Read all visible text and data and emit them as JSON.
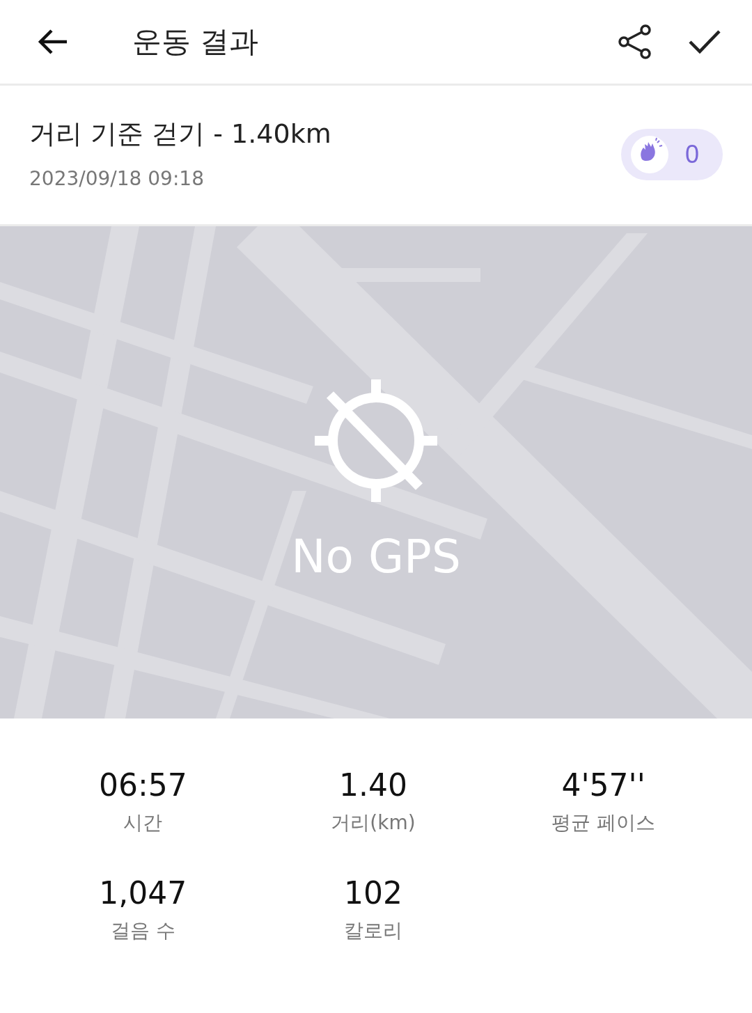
{
  "header": {
    "title": "운동 결과"
  },
  "workout": {
    "title": "거리 기준 걷기 - 1.40km",
    "datetime": "2023/09/18 09:18",
    "claps": "0"
  },
  "map": {
    "kind": "picture",
    "message": "No GPS"
  },
  "stats": [
    {
      "value": "06:57",
      "label": "시간"
    },
    {
      "value": "1.40",
      "label": "거리(km)"
    },
    {
      "value": "4'57''",
      "label": "평균 페이스"
    },
    {
      "value": "1,047",
      "label": "걸음 수"
    },
    {
      "value": "102",
      "label": "칼로리"
    }
  ]
}
